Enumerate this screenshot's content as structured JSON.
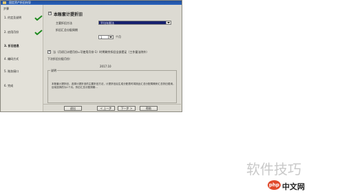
{
  "window": {
    "title": "固定资产折旧向导"
  },
  "sidebar": {
    "header": "步骤",
    "steps": [
      {
        "label": "1. 约定及说明",
        "done": true
      },
      {
        "label": "2. 启用月份",
        "done": true
      },
      {
        "label": "3. 折旧信息",
        "done": false
      },
      {
        "label": "4. 编码方式",
        "done": false
      },
      {
        "label": "5. 账务接口",
        "done": false
      },
      {
        "label": "6. 完成",
        "done": false
      }
    ]
  },
  "content": {
    "no_depreciation": {
      "label": "本账套计提折旧",
      "checked": true
    },
    "method": {
      "label": "主要折旧方法",
      "value": "平均年限法"
    },
    "period": {
      "label": "折旧汇总分配周期",
      "value": "1",
      "unit": "个月"
    },
    "last_month": {
      "label": "当（月初已计提月份=可使用月份-1）时将剩余折旧全部提足（工作量法除外）",
      "checked": true
    },
    "next_alloc_label": "下次折旧分配月份：",
    "next_alloc_date": "2017.10",
    "explain": {
      "legend": "说明",
      "text": "本账套计提折旧，选择计提折旧的主要折旧方法，计提折旧后生成分配表时将按此汇总分配周期来汇总折旧费用，目前选择的为1个月。折旧汇总分配周期..."
    }
  },
  "buttons": {
    "back": "退出",
    "prev": "< 上一步",
    "next": "下一步 >",
    "help": "帮助"
  },
  "watermark": {
    "text": "软件技巧",
    "logo_php": "php",
    "logo_site": "中文网"
  }
}
